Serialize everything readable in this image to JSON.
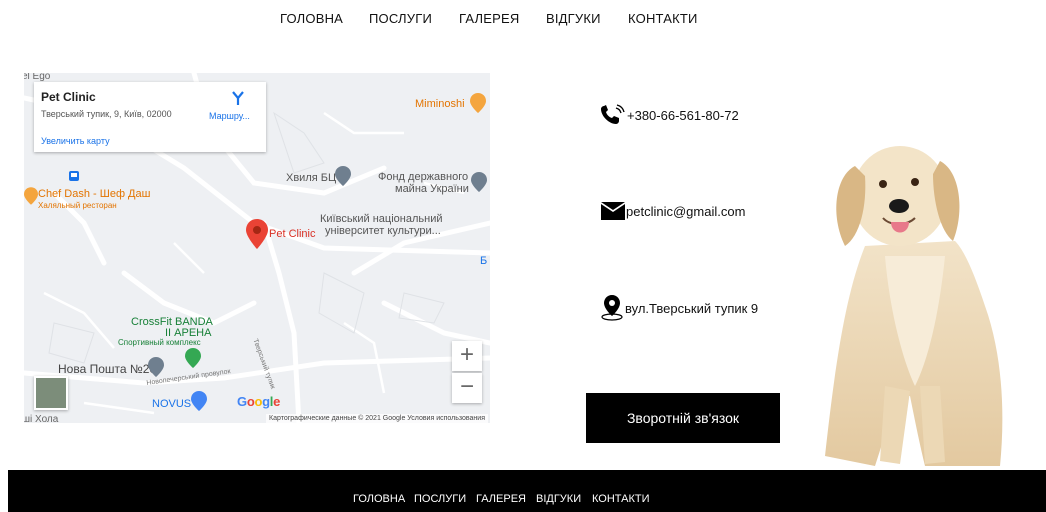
{
  "nav": {
    "items": [
      "ГОЛОВНА",
      "ПОСЛУГИ",
      "ГАЛЕРЕЯ",
      "ВІДГУКИ",
      "КОНТАКТИ"
    ]
  },
  "map": {
    "place_name": "Pet Clinic",
    "place_address": "Тверський тупик, 9, Київ, 02000",
    "enlarge_link": "Увеличить карту",
    "route_label": "Маршру...",
    "pin_label": "Pet Clinic",
    "labels": {
      "miminoshi": "Miminoshi",
      "chef_dash": "Chef Dash - Шеф Даш",
      "chef_dash_sub": "Халяльный ресторан",
      "khvylia": "Хвиля БЦ",
      "fond_1": "Фонд державного",
      "fond_2": "майна України",
      "univ_1": "Київський національний",
      "univ_2": "університет культури...",
      "crossfit_1": "CrossFit BANDA",
      "crossfit_2": "II АРЕНА",
      "crossfit_sub": "Спортивный комплекс",
      "nova_poshta": "Нова Пошта №20",
      "novus": "NOVUS",
      "street_tverskyi": "Тверський тупик",
      "street_novopech": "Новопечерський провулок",
      "top_partial": "el Ego",
      "right_partial": "Б",
      "bottom_partial": "ші Хола"
    },
    "zoom_in": "+",
    "zoom_out": "−",
    "google_logo": "Google",
    "attribution": "Картографические данные © 2021 Google   Условия использования"
  },
  "contacts": {
    "phone": "+380-66-561-80-72",
    "email": "petclinic@gmail.com",
    "address": "вул.Тверський тупик 9"
  },
  "feedback_button": "Зворотній зв'язок",
  "footer": {
    "items": [
      "ГОЛОВНА",
      "ПОСЛУГИ",
      "ГАЛЕРЕЯ",
      "ВІДГУКИ",
      "КОНТАКТИ"
    ]
  },
  "colors": {
    "accent_black": "#000000",
    "map_link_blue": "#1a73e8",
    "pin_red": "#ea4335",
    "poi_orange": "#f4a53e",
    "poi_green": "#34a853",
    "poi_gray": "#6f7f8f"
  }
}
